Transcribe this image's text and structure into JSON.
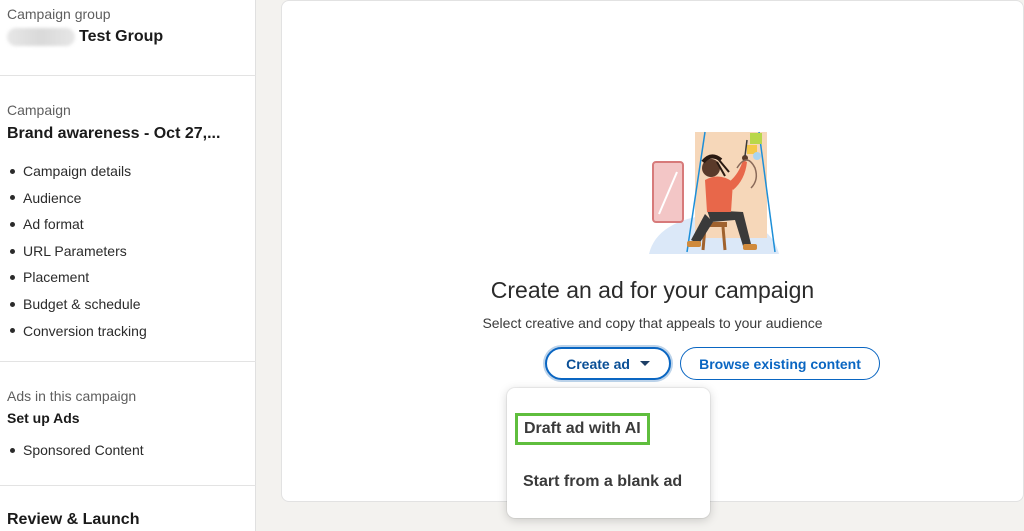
{
  "sidebar": {
    "campaign_group": {
      "label": "Campaign group",
      "name": "Test Group"
    },
    "campaign": {
      "label": "Campaign",
      "name": "Brand awareness - Oct 27,...",
      "steps": [
        "Campaign details",
        "Audience",
        "Ad format",
        "URL Parameters",
        "Placement",
        "Budget & schedule",
        "Conversion tracking"
      ]
    },
    "ads": {
      "label": "Ads in this campaign",
      "title": "Set up Ads",
      "items": [
        "Sponsored Content"
      ]
    },
    "review": {
      "title": "Review & Launch"
    }
  },
  "main": {
    "headline": "Create an ad for your campaign",
    "subline": "Select creative and copy that appeals to your audience",
    "create_button": "Create ad",
    "browse_button": "Browse existing content",
    "dropdown": {
      "items": [
        "Draft ad with AI",
        "Start from a blank ad"
      ]
    }
  },
  "colors": {
    "accent": "#0a66c2",
    "highlight": "#5fbe3d"
  }
}
